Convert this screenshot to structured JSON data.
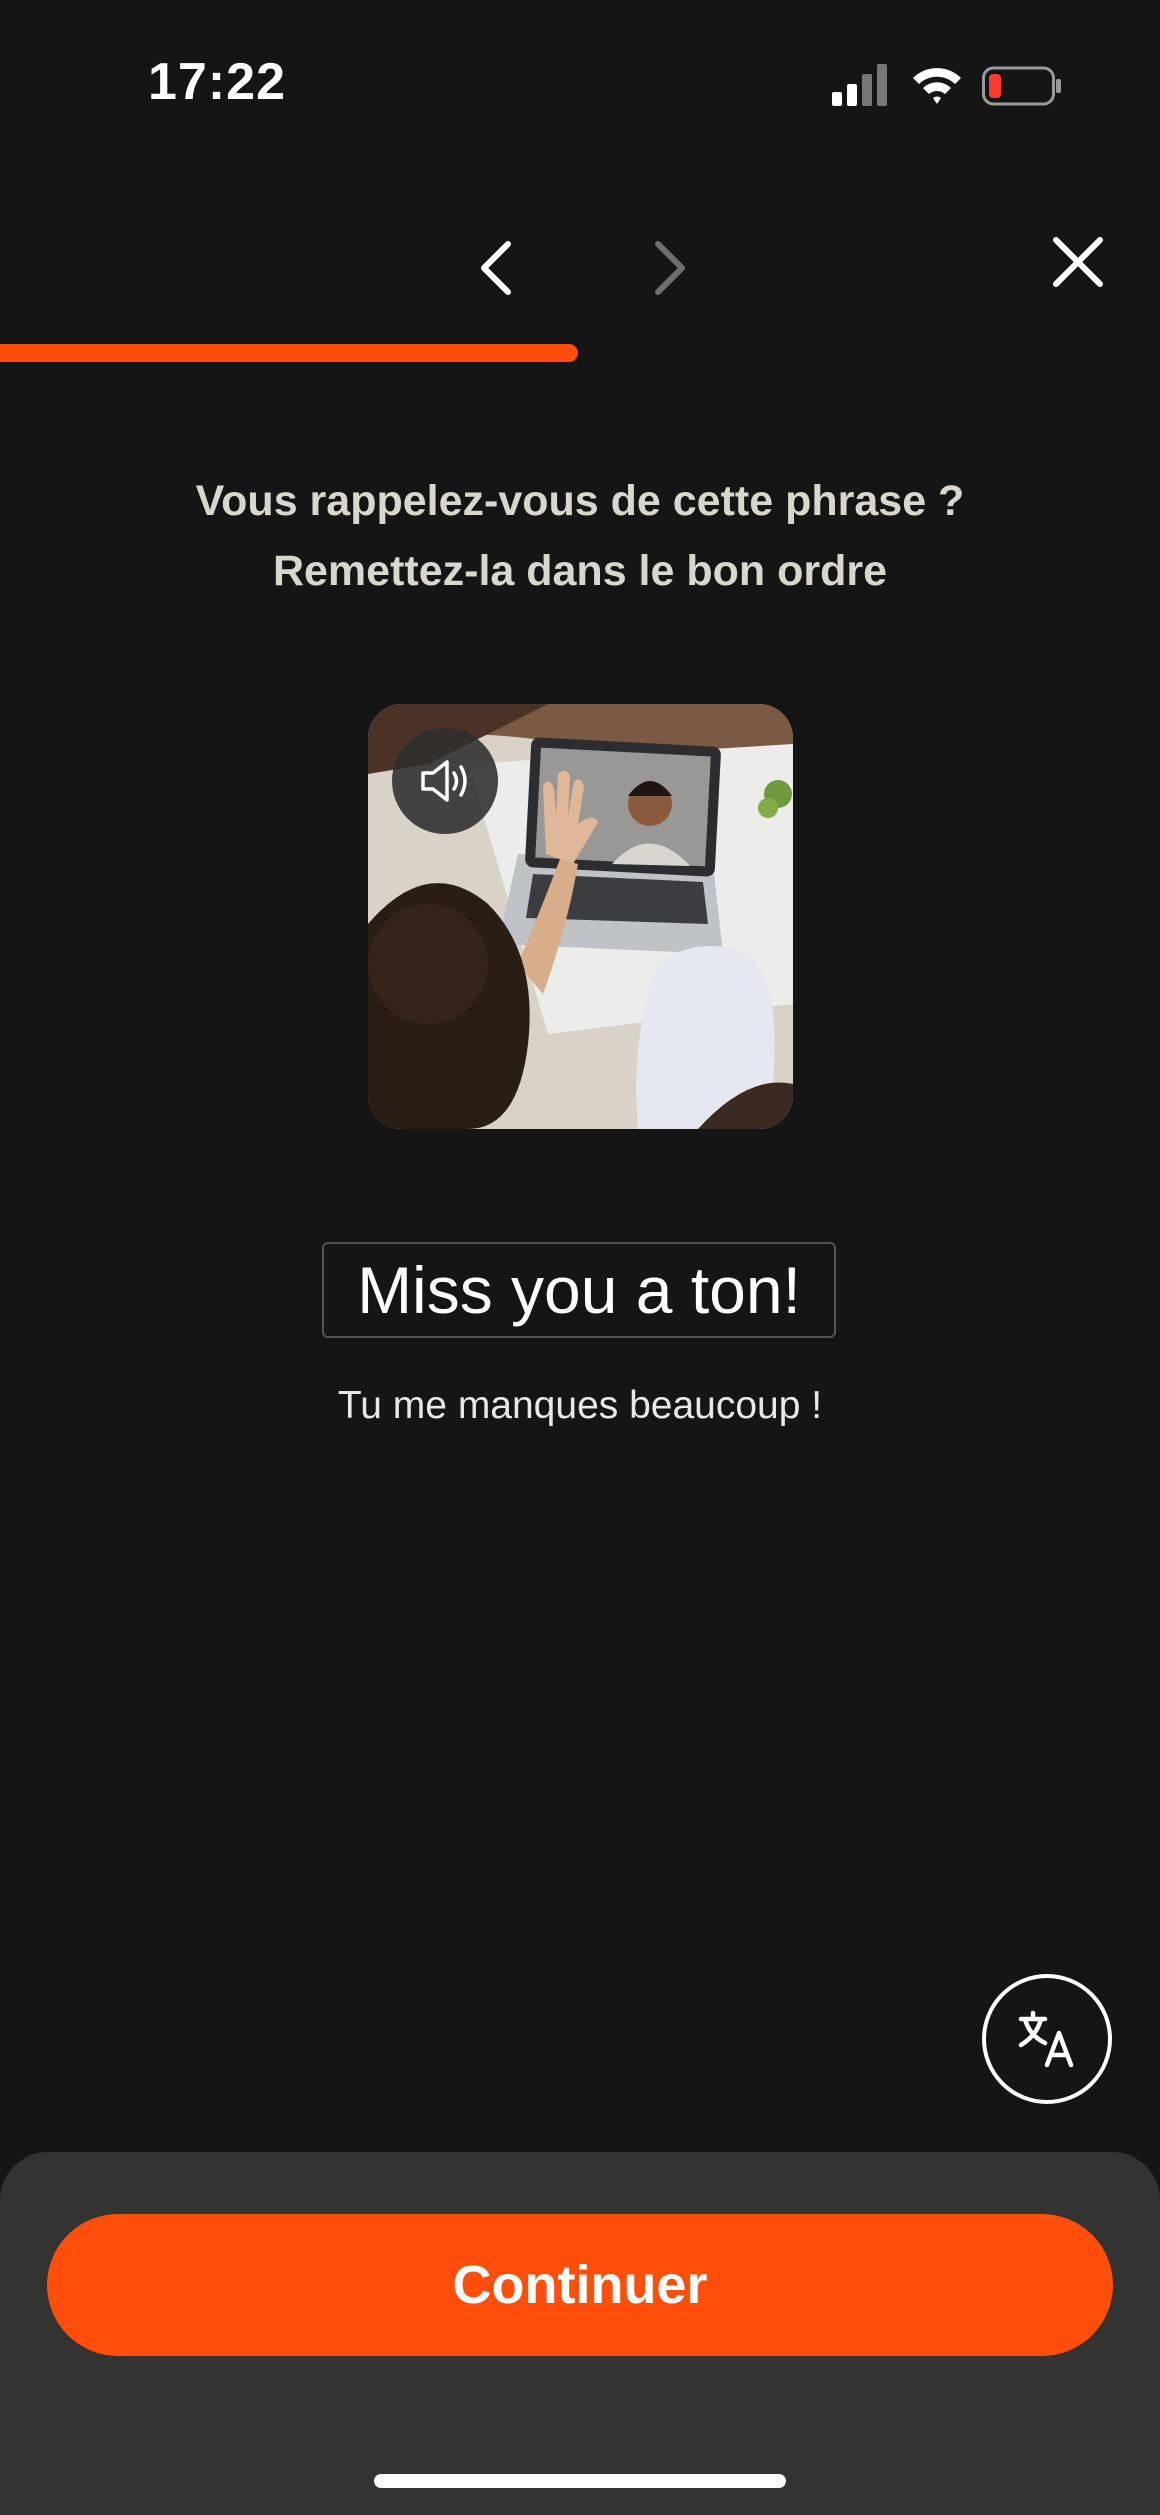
{
  "status_bar": {
    "time": "17:22",
    "icons": [
      "cellular-signal-icon",
      "wifi-icon",
      "battery-low-icon"
    ],
    "battery_color": "#ff3b30"
  },
  "nav": {
    "back_icon": "chevron-left-icon",
    "forward_icon": "chevron-right-icon",
    "close_icon": "close-icon"
  },
  "progress": {
    "value": 0.5,
    "color": "#ff4f0a"
  },
  "instruction": {
    "line1": "Vous rappelez-vous de cette phrase ?",
    "line2": "Remettez-la dans le bon ordre"
  },
  "card": {
    "audio_icon": "speaker-icon"
  },
  "phrase": {
    "text": "Miss you a ton!",
    "translation": "Tu me manques beaucoup !"
  },
  "translate_button": {
    "icon": "translate-icon"
  },
  "footer": {
    "continue_label": "Continuer",
    "accent": "#ff4f0a"
  }
}
